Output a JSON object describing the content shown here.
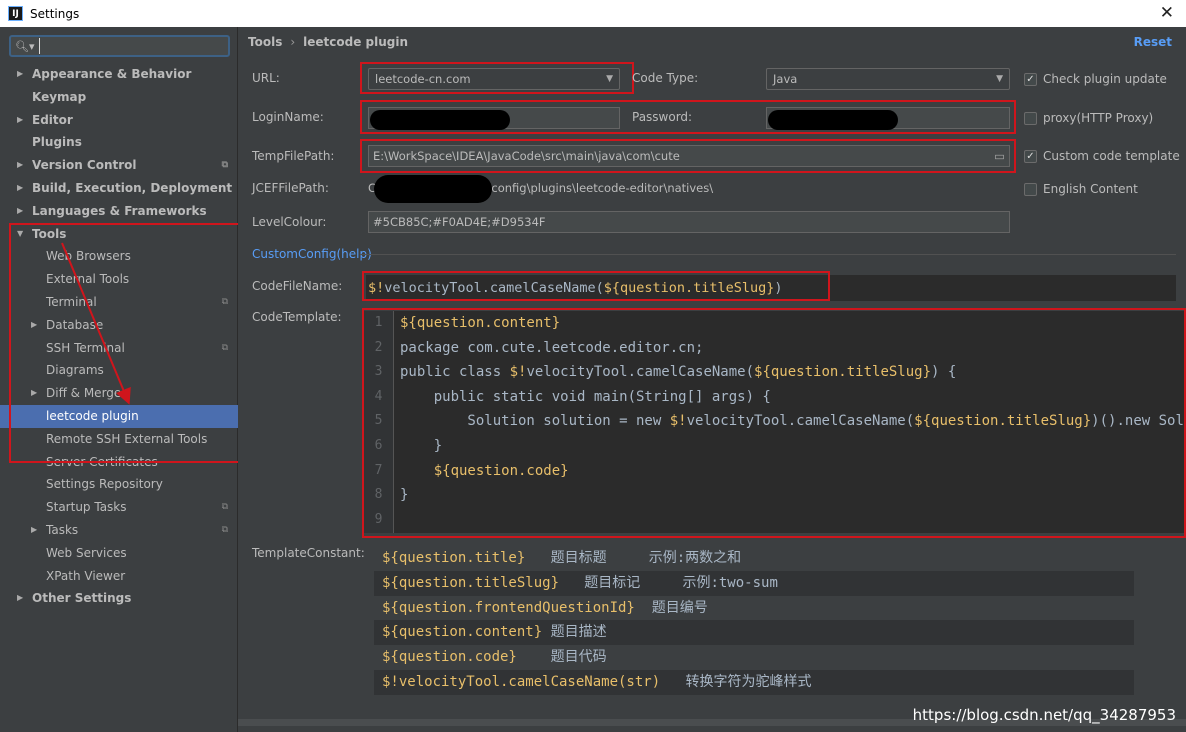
{
  "window": {
    "title": "Settings",
    "app_icon": "intellij-icon"
  },
  "search": {
    "placeholder": ""
  },
  "sidebar": {
    "items": [
      {
        "label": "Appearance & Behavior",
        "expand": "collapsed",
        "indent": 0,
        "bold": true
      },
      {
        "label": "Keymap",
        "expand": "none",
        "indent": 0,
        "bold": true
      },
      {
        "label": "Editor",
        "expand": "collapsed",
        "indent": 0,
        "bold": true
      },
      {
        "label": "Plugins",
        "expand": "none",
        "indent": 0,
        "bold": true
      },
      {
        "label": "Version Control",
        "expand": "collapsed",
        "indent": 0,
        "bold": true,
        "proj": true
      },
      {
        "label": "Build, Execution, Deployment",
        "expand": "collapsed",
        "indent": 0,
        "bold": true
      },
      {
        "label": "Languages & Frameworks",
        "expand": "collapsed",
        "indent": 0,
        "bold": true
      },
      {
        "label": "Tools",
        "expand": "expanded",
        "indent": 0,
        "bold": true
      },
      {
        "label": "Web Browsers",
        "expand": "none",
        "indent": 1
      },
      {
        "label": "External Tools",
        "expand": "none",
        "indent": 1
      },
      {
        "label": "Terminal",
        "expand": "none",
        "indent": 1,
        "proj": true
      },
      {
        "label": "Database",
        "expand": "collapsed",
        "indent": 1
      },
      {
        "label": "SSH Terminal",
        "expand": "none",
        "indent": 1,
        "proj": true
      },
      {
        "label": "Diagrams",
        "expand": "none",
        "indent": 1
      },
      {
        "label": "Diff & Merge",
        "expand": "collapsed",
        "indent": 1
      },
      {
        "label": "leetcode plugin",
        "expand": "none",
        "indent": 1,
        "selected": true
      },
      {
        "label": "Remote SSH External Tools",
        "expand": "none",
        "indent": 1
      },
      {
        "label": "Server Certificates",
        "expand": "none",
        "indent": 1
      },
      {
        "label": "Settings Repository",
        "expand": "none",
        "indent": 1
      },
      {
        "label": "Startup Tasks",
        "expand": "none",
        "indent": 1,
        "proj": true
      },
      {
        "label": "Tasks",
        "expand": "collapsed",
        "indent": 1,
        "proj": true
      },
      {
        "label": "Web Services",
        "expand": "none",
        "indent": 1
      },
      {
        "label": "XPath Viewer",
        "expand": "none",
        "indent": 1
      },
      {
        "label": "Other Settings",
        "expand": "collapsed",
        "indent": 0,
        "bold": true
      }
    ]
  },
  "breadcrumb": {
    "parent": "Tools",
    "separator": "›",
    "current": "leetcode plugin"
  },
  "reset_label": "Reset",
  "form": {
    "url_label": "URL:",
    "url_value": "leetcode-cn.com",
    "code_type_label": "Code Type:",
    "code_type_value": "Java",
    "login_label": "LoginName:",
    "login_value": "",
    "password_label": "Password:",
    "password_value": "",
    "temp_label": "TempFilePath:",
    "temp_value": "E:\\WorkSpace\\IDEA\\JavaCode\\src\\main\\java\\com\\cute",
    "jcef_label": "JCEFFilePath:",
    "jcef_value": "C:                    .IntelliJIdea2018.3\\config\\plugins\\leetcode-editor\\natives\\",
    "level_label": "LevelColour:",
    "level_value": "#5CB85C;#F0AD4E;#D9534F",
    "custom_link": "CustomConfig(help)",
    "codefile_label": "CodeFileName:",
    "codetemplate_label": "CodeTemplate:",
    "templateconst_label": "TemplateConstant:"
  },
  "checkboxes": {
    "check_update": {
      "label": "Check plugin update",
      "checked": true
    },
    "proxy": {
      "label": "proxy(HTTP Proxy)",
      "checked": false
    },
    "custom_template": {
      "label": "Custom code template",
      "checked": true
    },
    "english": {
      "label": "English Content",
      "checked": false
    }
  },
  "codefile": {
    "prefix": "$!",
    "mid": "velocityTool.camelCaseName(",
    "var": "${question.titleSlug}",
    "suffix": ")"
  },
  "code_template": {
    "line_numbers": [
      "1",
      "2",
      "3",
      "4",
      "5",
      "6",
      "7",
      "8",
      "9"
    ],
    "lines": [
      [
        {
          "t": "${question.content}",
          "c": "d"
        }
      ],
      [
        {
          "t": "package com.cute.leetcode.editor.cn;",
          "c": "kw"
        }
      ],
      [
        {
          "t": "public class ",
          "c": "kw"
        },
        {
          "t": "$!",
          "c": "d"
        },
        {
          "t": "velocityTool.camelCaseName(",
          "c": "kw"
        },
        {
          "t": "${question.titleSlug}",
          "c": "d"
        },
        {
          "t": ") {",
          "c": "kw"
        }
      ],
      [
        {
          "t": "    public static void main(String[] args) {",
          "c": "kw"
        }
      ],
      [
        {
          "t": "        Solution solution = new ",
          "c": "kw"
        },
        {
          "t": "$!",
          "c": "d"
        },
        {
          "t": "velocityTool.camelCaseName(",
          "c": "kw"
        },
        {
          "t": "${question.titleSlug}",
          "c": "d"
        },
        {
          "t": ")().new Solut",
          "c": "kw"
        }
      ],
      [
        {
          "t": "    }",
          "c": "kw"
        }
      ],
      [
        {
          "t": "    ",
          "c": "kw"
        },
        {
          "t": "${question.code}",
          "c": "d"
        }
      ],
      [
        {
          "t": "}",
          "c": "kw"
        }
      ],
      [
        {
          "t": "",
          "c": "kw"
        }
      ]
    ]
  },
  "template_constants": [
    {
      "var": "${question.title}",
      "desc": "   题目标题     示例:两数之和"
    },
    {
      "var": "${question.titleSlug}",
      "desc": "   题目标记     示例:two-sum"
    },
    {
      "var": "${question.frontendQuestionId}",
      "desc": "  题目编号"
    },
    {
      "var": "${question.content}",
      "desc": " 题目描述"
    },
    {
      "var": "${question.code}",
      "desc": "    题目代码"
    },
    {
      "var": "$!velocityTool.camelCaseName(str)",
      "desc": "   转换字符为驼峰样式"
    }
  ],
  "watermark": "https://blog.csdn.net/qq_34287953",
  "colors": {
    "accent": "#4b6eaf",
    "link": "#589df6",
    "annotation": "#d0151c",
    "variable": "#e8bf6a"
  }
}
